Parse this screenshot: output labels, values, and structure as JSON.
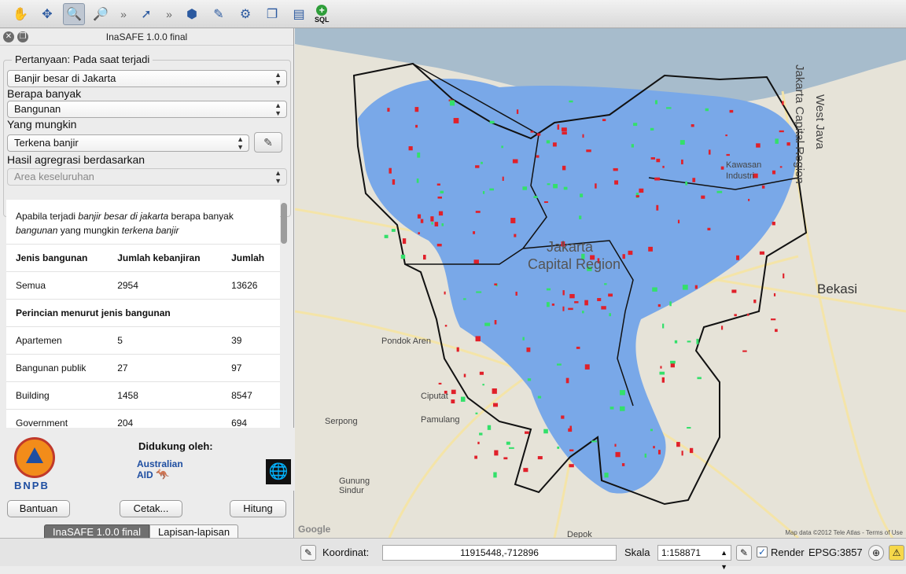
{
  "toolbar": {
    "icons": [
      "pan-icon",
      "pan-to-selection-icon",
      "zoom-in-icon",
      "zoom-out-icon",
      "identify-icon",
      "inasafe-icon",
      "edit-icon",
      "settings-icon",
      "package-icon",
      "table-icon"
    ],
    "overflow_glyph": "»",
    "sql_label": "SQL"
  },
  "panel": {
    "title": "InaSAFE 1.0.0 final",
    "question_title": "Pertanyaan: Pada saat terjadi",
    "hazard_value": "Banjir besar di Jakarta",
    "exposure_label": "Berapa banyak",
    "exposure_value": "Bangunan",
    "function_label": "Yang mungkin",
    "function_value": "Terkena banjir",
    "aggregation_label": "Hasil agregrasi berdasarkan",
    "aggregation_value": "Area keseluruhan"
  },
  "report": {
    "intro_prefix": "Apabila terjadi ",
    "intro_hazard": "banjir besar di jakarta",
    "intro_mid": " berapa banyak ",
    "intro_exposure": "bangunan",
    "intro_mid2": " yang mungkin ",
    "intro_impact": "terkena banjir",
    "headers": [
      "Jenis bangunan",
      "Jumlah kebanjiran",
      "Jumlah"
    ],
    "total_row": [
      "Semua",
      "2954",
      "13626"
    ],
    "breakdown_title": "Perincian menurut jenis bangunan",
    "rows": [
      [
        "Apartemen",
        "5",
        "39"
      ],
      [
        "Bangunan publik",
        "27",
        "97"
      ],
      [
        "Building",
        "1458",
        "8547"
      ],
      [
        "Government",
        "204",
        "694"
      ]
    ]
  },
  "logos": {
    "bnpb_text": "BNPB",
    "support_label": "Didukung oleh:",
    "aid_line1": "Australian",
    "aid_line2": "AID"
  },
  "buttons": {
    "help": "Bantuan",
    "print": "Cetak...",
    "run": "Hitung"
  },
  "tabs": [
    "InaSAFE 1.0.0 final",
    "Lapisan-lapisan"
  ],
  "map": {
    "labels": {
      "jakarta": "Jakarta",
      "capital_region": "Capital Region",
      "bekasi": "Bekasi",
      "west_java": "West Java",
      "jakarta_capital_region_vert": "Jakarta Capital Region",
      "kawasan": "Kawasan",
      "industri": "Industri",
      "pondok_aren": "Pondok Aren",
      "ciputat": "Ciputat",
      "serpong": "Serpong",
      "pamulang": "Pamulang",
      "gunung_sindur": "Gunung\nSindur",
      "depok": "Depok",
      "google": "Google"
    },
    "attribution": "Map data ©2012 Tele Atlas - Terms of Use",
    "colors": {
      "flooded": "#79a8e8",
      "buildings_flooded": "#e0202a",
      "buildings_safe": "#33e06a",
      "sea": "#a7bccc",
      "boundary": "#111111"
    }
  },
  "status": {
    "coord_label": "Koordinat:",
    "coord_value": "11915448,-712896",
    "scale_label": "Skala",
    "scale_value": "1:158871",
    "render_label": "Render",
    "render_checked": true,
    "crs": "EPSG:3857"
  }
}
